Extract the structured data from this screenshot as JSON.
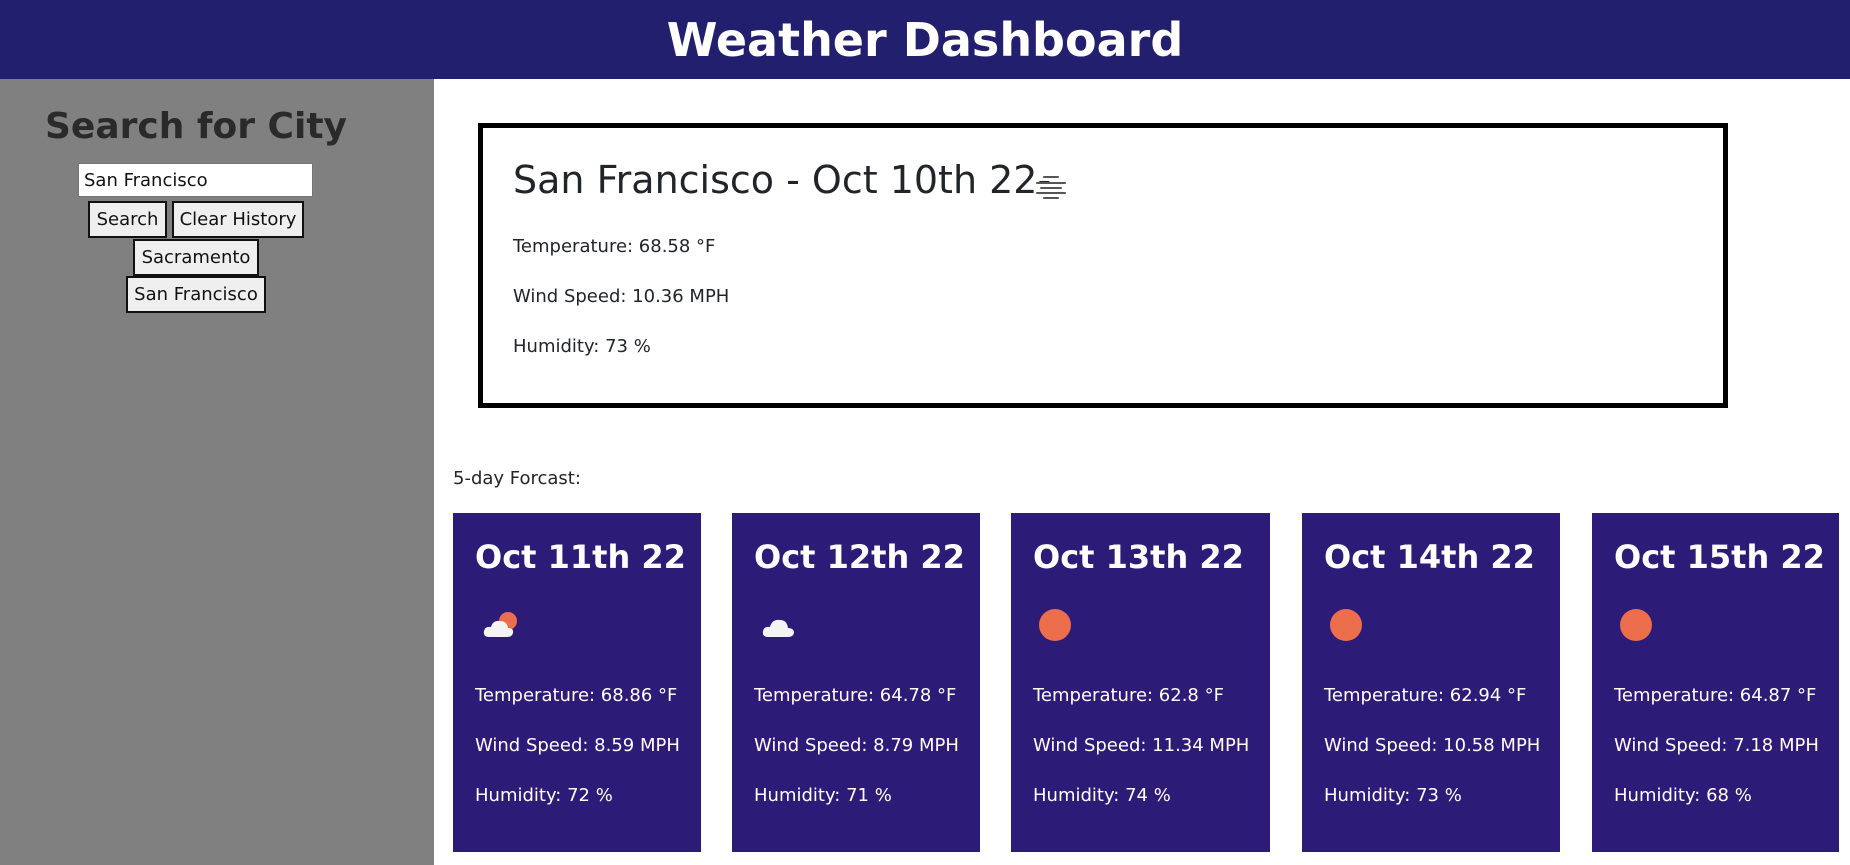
{
  "header": {
    "title": "Weather Dashboard"
  },
  "sidebar": {
    "heading": "Search for City",
    "search_value": "San Francisco",
    "search_button": "Search",
    "clear_button": "Clear History",
    "history": [
      "Sacramento",
      "San Francisco"
    ]
  },
  "current": {
    "title": "San Francisco - Oct 10th 22-",
    "icon": "mist-icon",
    "temperature": "Temperature: 68.58 °F",
    "wind": "Wind Speed: 10.36 MPH",
    "humidity": "Humidity: 73 %"
  },
  "forecast": {
    "label": "5-day Forcast:",
    "days": [
      {
        "date": "Oct 11th 22",
        "icon": "partly-cloudy-icon",
        "temperature": "Temperature: 68.86 °F",
        "wind": "Wind Speed: 8.59 MPH",
        "humidity": "Humidity: 72 %"
      },
      {
        "date": "Oct 12th 22",
        "icon": "cloud-icon",
        "temperature": "Temperature: 64.78 °F",
        "wind": "Wind Speed: 8.79 MPH",
        "humidity": "Humidity: 71 %"
      },
      {
        "date": "Oct 13th 22",
        "icon": "sun-icon",
        "temperature": "Temperature: 62.8 °F",
        "wind": "Wind Speed: 11.34 MPH",
        "humidity": "Humidity: 74 %"
      },
      {
        "date": "Oct 14th 22",
        "icon": "sun-icon",
        "temperature": "Temperature: 62.94 °F",
        "wind": "Wind Speed: 10.58 MPH",
        "humidity": "Humidity: 73 %"
      },
      {
        "date": "Oct 15th 22",
        "icon": "sun-icon",
        "temperature": "Temperature: 64.87 °F",
        "wind": "Wind Speed: 7.18 MPH",
        "humidity": "Humidity: 68 %"
      }
    ]
  },
  "colors": {
    "header_bg": "#221f6e",
    "sidebar_bg": "#808080",
    "card_bg": "#2d1b78",
    "sun": "#ec6e4c"
  }
}
